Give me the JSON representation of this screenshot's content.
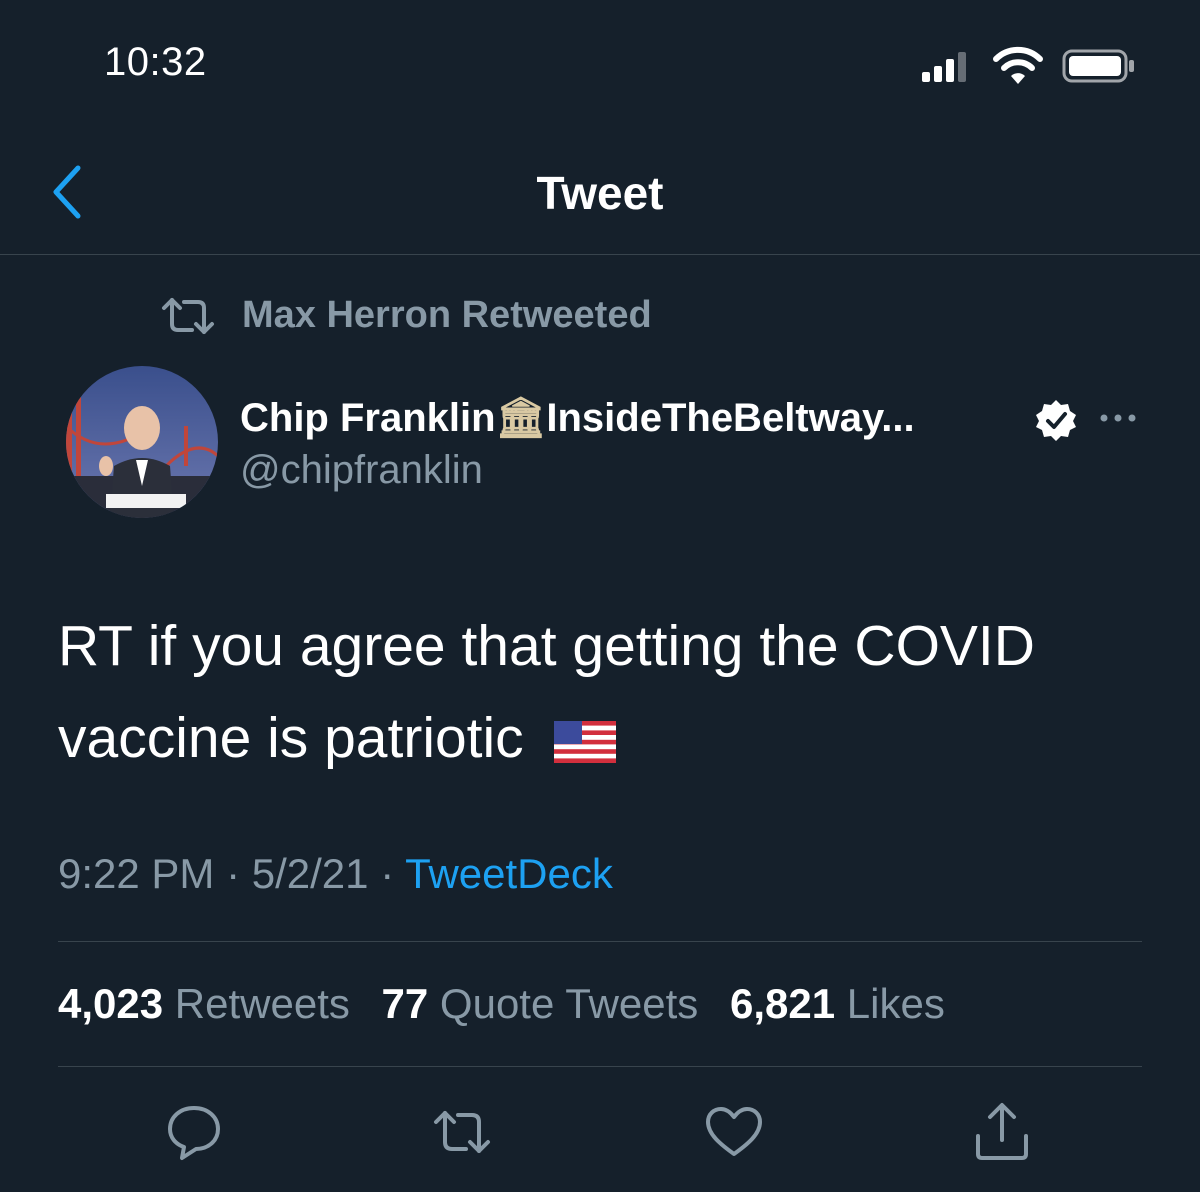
{
  "status_bar": {
    "time": "10:32"
  },
  "nav": {
    "title": "Tweet",
    "back_icon": "chevron-left-icon"
  },
  "retweet_context": {
    "text": "Max Herron Retweeted"
  },
  "author": {
    "display_name": "Chip Franklin",
    "name_emoji": "🏛",
    "name_suffix": "InsideTheBeltway...",
    "handle": "@chipfranklin",
    "verified": true
  },
  "tweet": {
    "text": "RT if you agree that getting the COVID vaccine is patriotic",
    "emoji": "🇺🇸"
  },
  "meta": {
    "time": "9:22 PM",
    "sep1": " · ",
    "date": "5/2/21",
    "sep2": " · ",
    "source": "TweetDeck"
  },
  "stats": {
    "retweets_count": "4,023",
    "retweets_label": "Retweets",
    "quotes_count": "77",
    "quotes_label": "Quote Tweets",
    "likes_count": "6,821",
    "likes_label": "Likes"
  },
  "actions": [
    "reply-icon",
    "retweet-icon",
    "like-icon",
    "share-icon"
  ],
  "colors": {
    "background": "#15202b",
    "accent": "#1da1f2",
    "secondary_text": "#8899a6",
    "divider": "#38444d"
  }
}
